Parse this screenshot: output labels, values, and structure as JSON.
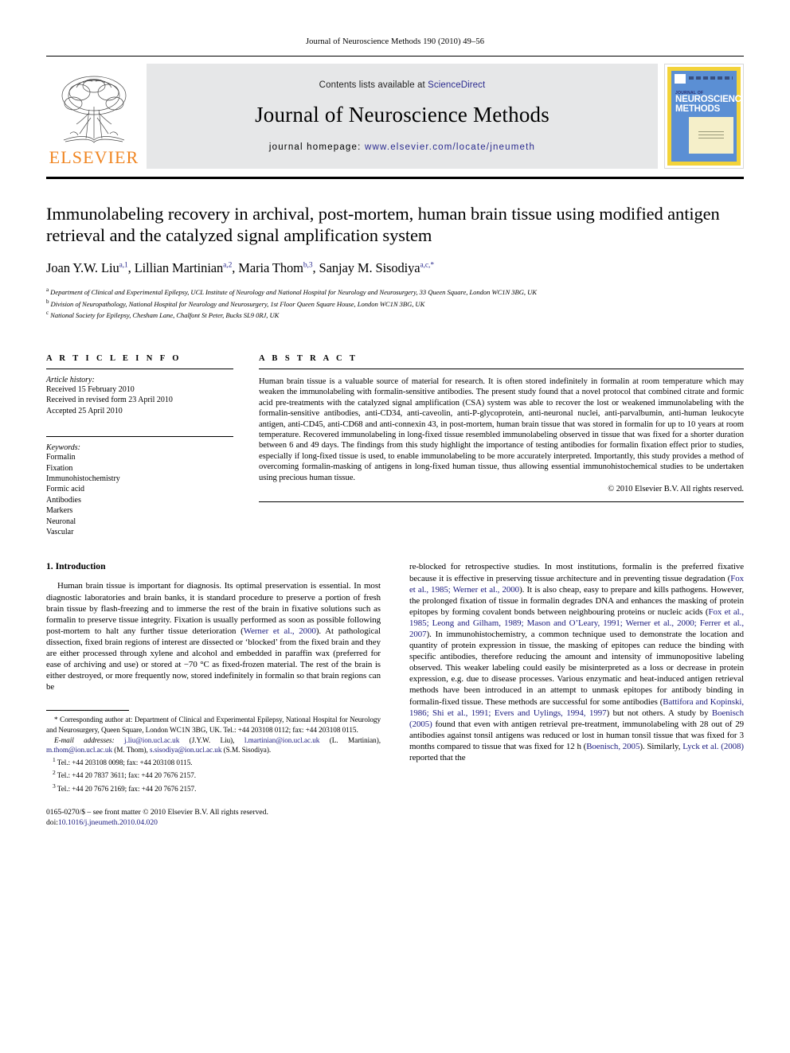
{
  "running_head": "Journal of Neuroscience Methods 190 (2010) 49–56",
  "masthead": {
    "publisher": "ELSEVIER",
    "contents_prefix": "Contents lists available at ",
    "contents_link": "ScienceDirect",
    "journal_title": "Journal of Neuroscience Methods",
    "homepage_label": "journal homepage:",
    "homepage_url": "www.elsevier.com/locate/jneumeth",
    "cover": {
      "small_label": "JOURNAL OF",
      "title_line1": "NEUROSCIENCE",
      "title_line2": "METHODS"
    },
    "colors": {
      "elsevier_orange": "#F08521",
      "banner_gray": "#e6e7e8",
      "link_blue": "#2b2b8f",
      "cover_yellow": "#f3d33a",
      "cover_blue": "#5b8fd4",
      "cover_panel": "#f5efc9"
    }
  },
  "article": {
    "title": "Immunolabeling recovery in archival, post-mortem, human brain tissue using modified antigen retrieval and the catalyzed signal amplification system",
    "authors_html": "Joan Y.W. Liu<sup>a,1</sup>, Lillian Martinian<sup>a,2</sup>, Maria Thom<sup>b,3</sup>, Sanjay M. Sisodiya<sup>a,c,*</sup>",
    "affiliations": [
      {
        "marker": "a",
        "text": "Department of Clinical and Experimental Epilepsy, UCL Institute of Neurology and National Hospital for Neurology and Neurosurgery, 33 Queen Square, London WC1N 3BG, UK"
      },
      {
        "marker": "b",
        "text": "Division of Neuropathology, National Hospital for Neurology and Neurosurgery, 1st Floor Queen Square House, London WC1N 3BG, UK"
      },
      {
        "marker": "c",
        "text": "National Society for Epilepsy, Chesham Lane, Chalfont St Peter, Bucks SL9 0RJ, UK"
      }
    ]
  },
  "article_info": {
    "heading": "A R T I C L E    I N F O",
    "history_label": "Article history:",
    "history": [
      "Received 15 February 2010",
      "Received in revised form 23 April 2010",
      "Accepted 25 April 2010"
    ],
    "keywords_label": "Keywords:",
    "keywords": [
      "Formalin",
      "Fixation",
      "Immunohistochemistry",
      "Formic acid",
      "Antibodies",
      "Markers",
      "Neuronal",
      "Vascular"
    ]
  },
  "abstract": {
    "heading": "A B S T R A C T",
    "text": "Human brain tissue is a valuable source of material for research. It is often stored indefinitely in formalin at room temperature which may weaken the immunolabeling with formalin-sensitive antibodies. The present study found that a novel protocol that combined citrate and formic acid pre-treatments with the catalyzed signal amplification (CSA) system was able to recover the lost or weakened immunolabeling with the formalin-sensitive antibodies, anti-CD34, anti-caveolin, anti-P-glycoprotein, anti-neuronal nuclei, anti-parvalbumin, anti-human leukocyte antigen, anti-CD45, anti-CD68 and anti-connexin 43, in post-mortem, human brain tissue that was stored in formalin for up to 10 years at room temperature. Recovered immunolabeling in long-fixed tissue resembled immunolabeling observed in tissue that was fixed for a shorter duration between 6 and 49 days. The findings from this study highlight the importance of testing antibodies for formalin fixation effect prior to studies, especially if long-fixed tissue is used, to enable immunolabeling to be more accurately interpreted. Importantly, this study provides a method of overcoming formalin-masking of antigens in long-fixed human tissue, thus allowing essential immunohistochemical studies to be undertaken using precious human tissue.",
    "copyright": "© 2010 Elsevier B.V. All rights reserved."
  },
  "introduction": {
    "heading": "1.  Introduction",
    "left_paragraph_html": "Human brain tissue is important for diagnosis. Its optimal preservation is essential. In most diagnostic laboratories and brain banks, it is standard procedure to preserve a portion of fresh brain tissue by flash-freezing and to immerse the rest of the brain in fixative solutions such as formalin to preserve tissue integrity. Fixation is usually performed as soon as possible following post-mortem to halt any further tissue deterioration (<span class=\"cite\">Werner et al., 2000</span>). At pathological dissection, fixed brain regions of interest are dissected or ‘blocked’ from the fixed brain and they are either processed through xylene and alcohol and embedded in paraffin wax (preferred for ease of archiving and use) or stored at −70 °C as fixed-frozen material. The rest of the brain is either destroyed, or more frequently now, stored indefinitely in formalin so that brain regions can be",
    "right_paragraph_html": "re-blocked for retrospective studies. In most institutions, formalin is the preferred fixative because it is effective in preserving tissue architecture and in preventing tissue degradation (<span class=\"cite\">Fox et al., 1985; Werner et al., 2000</span>). It is also cheap, easy to prepare and kills pathogens. However, the prolonged fixation of tissue in formalin degrades DNA and enhances the masking of protein epitopes by forming covalent bonds between neighbouring proteins or nucleic acids (<span class=\"cite\">Fox et al., 1985; Leong and Gilham, 1989; Mason and O’Leary, 1991; Werner et al., 2000; Ferrer et al., 2007</span>). In immunohistochemistry, a common technique used to demonstrate the location and quantity of protein expression in tissue, the masking of epitopes can reduce the binding with specific antibodies, therefore reducing the amount and intensity of immunopositive labeling observed. This weaker labeling could easily be misinterpreted as a loss or decrease in protein expression, e.g. due to disease processes. Various enzymatic and heat-induced antigen retrieval methods have been introduced in an attempt to unmask epitopes for antibody binding in formalin-fixed tissue. These methods are successful for some antibodies (<span class=\"cite\">Battifora and Kopinski, 1986; Shi et al., 1991; Evers and Uylings, 1994, 1997</span>) but not others. A study by <span class=\"cite\">Boenisch (2005)</span> found that even with antigen retrieval pre-treatment, immunolabeling with 28 out of 29 antibodies against tonsil antigens was reduced or lost in human tonsil tissue that was fixed for 3 months compared to tissue that was fixed for 12 h (<span class=\"cite\">Boenisch, 2005</span>). Similarly, <span class=\"cite\">Lyck et al. (2008)</span> reported that the"
  },
  "footnotes": {
    "corresponding_html": "* Corresponding author at: Department of Clinical and Experimental Epilepsy, National Hospital for Neurology and Neurosurgery, Queen Square, London WC1N 3BG, UK. Tel.: +44 203108 0112; fax: +44 203108 0115.",
    "emails_html": "<i>E-mail addresses:</i> <span class=\"cite\">j.liu@ion.ucl.ac.uk</span> (J.Y.W. Liu), <span class=\"cite\">l.martinian@ion.ucl.ac.uk</span> (L. Martinian), <span class=\"cite\">m.thom@ion.ucl.ac.uk</span> (M. Thom), <span class=\"cite\">s.sisodiya@ion.ucl.ac.uk</span> (S.M. Sisodiya).",
    "numbered": [
      {
        "marker": "1",
        "text": "Tel.: +44 203108 0098; fax: +44 203108 0115."
      },
      {
        "marker": "2",
        "text": "Tel.: +44 20 7837 3611; fax: +44 20 7676 2157."
      },
      {
        "marker": "3",
        "text": "Tel.: +44 20 7676 2169; fax: +44 20 7676 2157."
      }
    ]
  },
  "issn_footer": {
    "line1": "0165-0270/$ – see front matter © 2010 Elsevier B.V. All rights reserved.",
    "doi_label": "doi:",
    "doi_value": "10.1016/j.jneumeth.2010.04.020"
  }
}
